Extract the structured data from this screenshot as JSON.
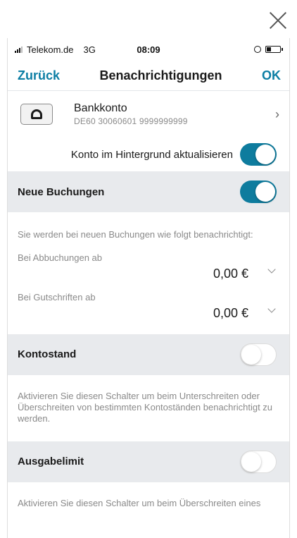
{
  "status": {
    "carrier": "Telekom.de",
    "network": "3G",
    "time": "08:09"
  },
  "nav": {
    "back": "Zurück",
    "title": "Benachrichtigungen",
    "ok": "OK"
  },
  "account": {
    "name": "Bankkonto",
    "iban": "DE60 30060601 9999999999",
    "logo_letter": "a"
  },
  "background_update": {
    "label": "Konto im Hintergrund aktualisieren",
    "enabled": true
  },
  "sections": {
    "neue_buchungen": {
      "title": "Neue Buchungen",
      "enabled": true,
      "info": "Sie werden bei neuen Buchungen wie folgt benachrichtigt:",
      "debits_label": "Bei Abbuchungen ab",
      "debits_value": "0,00 €",
      "credits_label": "Bei Gutschriften ab",
      "credits_value": "0,00 €"
    },
    "kontostand": {
      "title": "Kontostand",
      "enabled": false,
      "info": "Aktivieren Sie diesen Schalter um beim Unterschreiten oder Überschreiten von bestimmten Kontoständen benachrichtigt zu werden."
    },
    "ausgabelimit": {
      "title": "Ausgabelimit",
      "enabled": false,
      "info": "Aktivieren Sie diesen Schalter um beim Überschreiten eines"
    }
  },
  "colors": {
    "accent": "#0e7c9e",
    "section_bg": "#e8eaed",
    "muted_text": "#8a8a8a"
  }
}
